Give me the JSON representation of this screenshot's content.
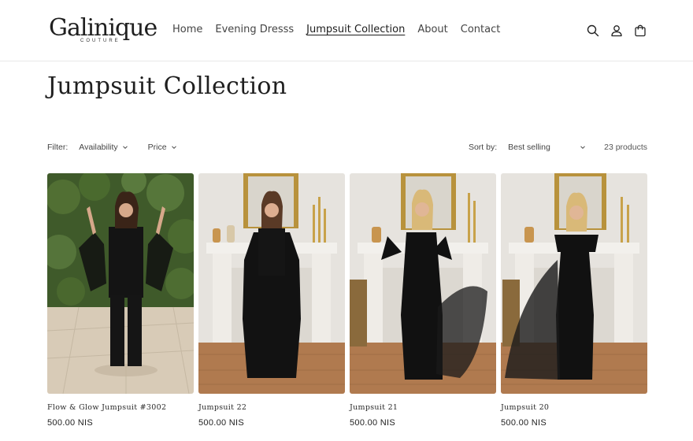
{
  "brand": {
    "name": "Galinique",
    "sub": "COUTURE"
  },
  "nav": [
    {
      "label": "Home",
      "active": false
    },
    {
      "label": "Evening Dresss",
      "active": false
    },
    {
      "label": "Jumpsuit Collection",
      "active": true
    },
    {
      "label": "About",
      "active": false
    },
    {
      "label": "Contact",
      "active": false
    }
  ],
  "header_icons": [
    "search-icon",
    "account-icon",
    "cart-icon"
  ],
  "page": {
    "title": "Jumpsuit Collection"
  },
  "filters": {
    "label": "Filter:",
    "availability": "Availability",
    "price": "Price",
    "sort_label": "Sort by:",
    "sort_value": "Best selling",
    "count": "23 products"
  },
  "products": [
    {
      "title": "Flow & Glow Jumpsuit #3002",
      "price": "500.00 NIS",
      "scene": "outdoor"
    },
    {
      "title": "Jumpsuit 22",
      "price": "500.00 NIS",
      "scene": "fireplace"
    },
    {
      "title": "Jumpsuit 21",
      "price": "500.00 NIS",
      "scene": "fireplace"
    },
    {
      "title": "Jumpsuit 20",
      "price": "500.00 NIS",
      "scene": "fireplace"
    }
  ]
}
